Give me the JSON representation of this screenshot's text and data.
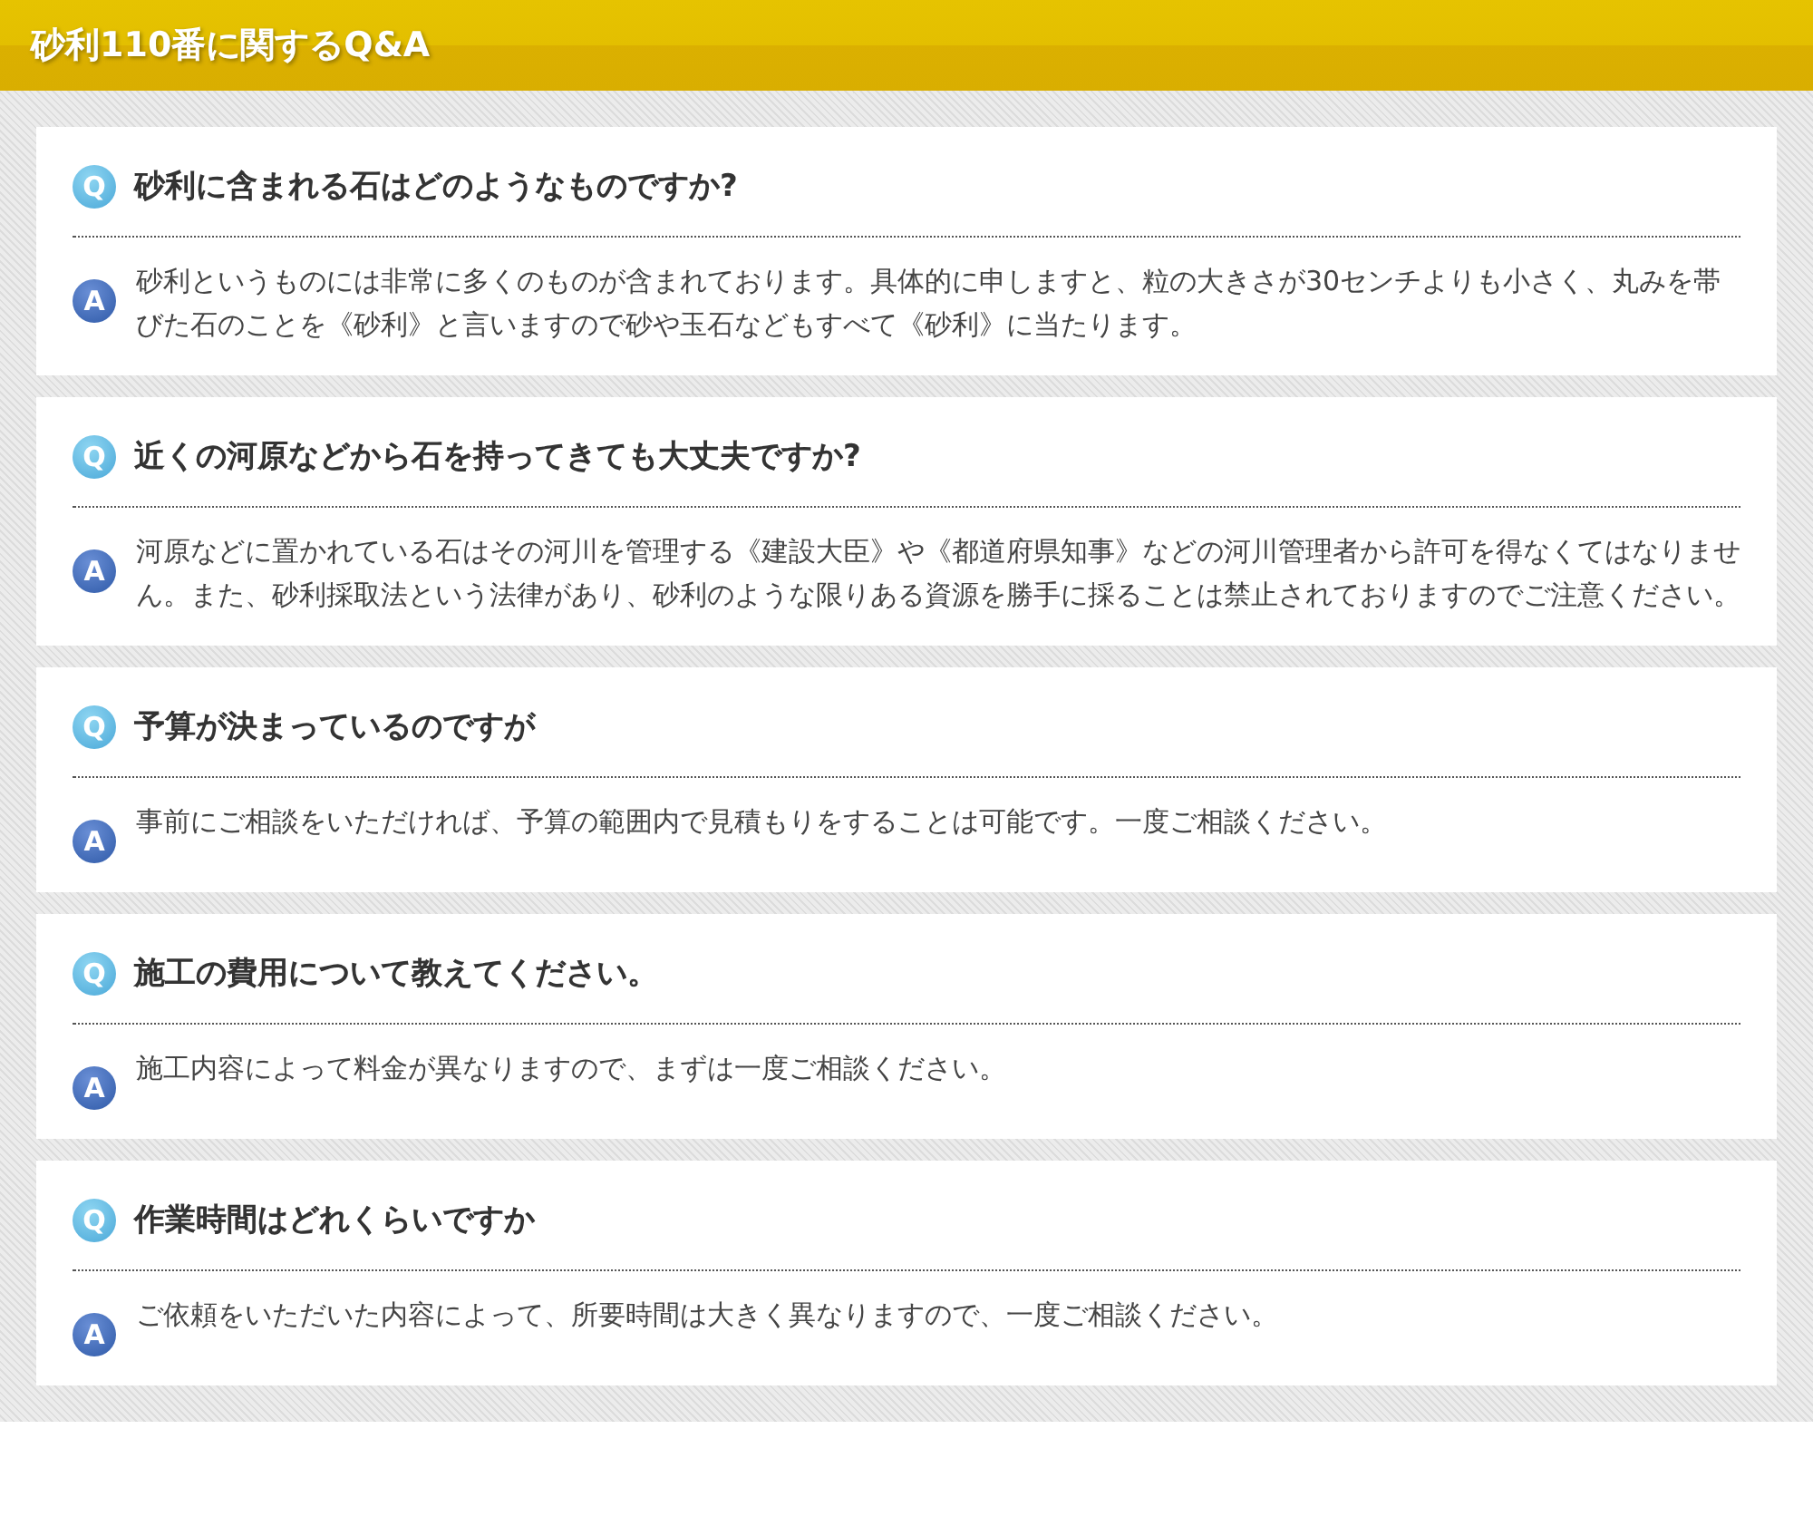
{
  "header": {
    "title": "砂利110番に関するQ&A"
  },
  "faq": [
    {
      "q_badge": "Q",
      "question": "砂利に含まれる石はどのようなものですか?",
      "a_badge": "A",
      "answer": "砂利というものには非常に多くのものが含まれております。具体的に申しますと、粒の大きさが30センチよりも小さく、丸みを帯びた石のことを《砂利》と言いますので砂や玉石などもすべて《砂利》に当たります。"
    },
    {
      "q_badge": "Q",
      "question": "近くの河原などから石を持ってきても大丈夫ですか?",
      "a_badge": "A",
      "answer": "河原などに置かれている石はその河川を管理する《建設大臣》や《都道府県知事》などの河川管理者から許可を得なくてはなりません。また、砂利採取法という法律があり、砂利のような限りある資源を勝手に採ることは禁止されておりますのでご注意ください。"
    },
    {
      "q_badge": "Q",
      "question": "予算が決まっているのですが",
      "a_badge": "A",
      "answer": "事前にご相談をいただければ、予算の範囲内で見積もりをすることは可能です。一度ご相談ください。"
    },
    {
      "q_badge": "Q",
      "question": "施工の費用について教えてください。",
      "a_badge": "A",
      "answer": "施工内容によって料金が異なりますので、まずは一度ご相談ください。"
    },
    {
      "q_badge": "Q",
      "question": "作業時間はどれくらいですか",
      "a_badge": "A",
      "answer": "ご依頼をいただいた内容によって、所要時間は大きく異なりますので、一度ご相談ください。"
    }
  ]
}
